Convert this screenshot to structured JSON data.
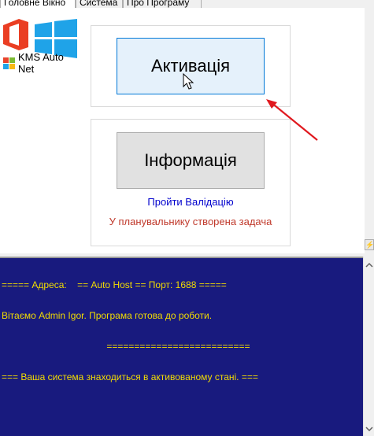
{
  "tabs": [
    {
      "label": "Головне Вікно",
      "active": true
    },
    {
      "label": "Система",
      "active": false
    },
    {
      "label": "Про Програму",
      "active": false
    }
  ],
  "sidebar": {
    "app_name": "KMS Auto Net",
    "icons": [
      "office-logo-icon",
      "windows-logo-icon",
      "kms-app-icon"
    ]
  },
  "buttons": {
    "activate": "Активація",
    "info": "Інформація"
  },
  "links": {
    "validate": "Пройти Валідацію"
  },
  "status": {
    "task_created": "У планувальнику створена задача"
  },
  "console": {
    "lines": [
      "===== Адреса:    == Auto Host == Порт: 1688 =====",
      "Вітаємо Admin Igor. Програма готова до роботи.",
      "                                        ==========================",
      "=== Ваша система знаходиться в активованому стані. ==="
    ]
  },
  "colors": {
    "console_bg": "#181a7e",
    "console_text": "#f2dc00",
    "link": "#0000cd",
    "status_text": "#c0392b",
    "arrow": "#e0191f"
  }
}
